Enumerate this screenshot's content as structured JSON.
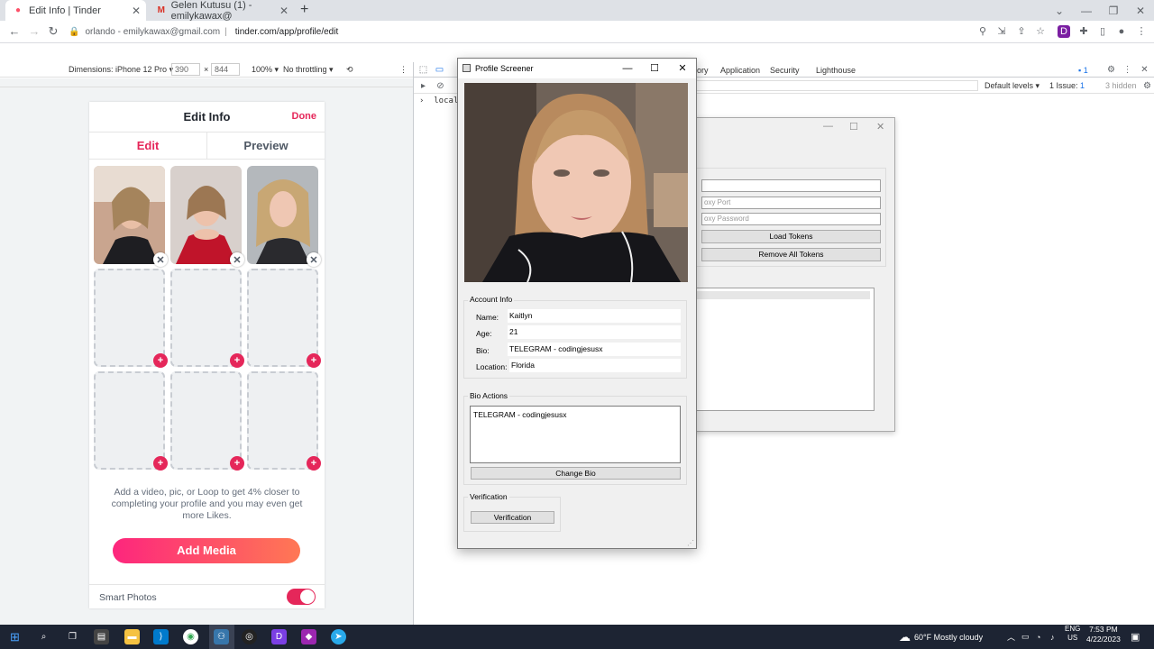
{
  "browser": {
    "tabs": [
      {
        "title": "Edit Info | Tinder",
        "active": true
      },
      {
        "title": "Gelen Kutusu (1) - emilykawax@",
        "active": false
      }
    ],
    "address": {
      "origin": "orlando - emilykawax@gmail.com",
      "separator": "|",
      "url": "tinder.com/app/profile/edit"
    }
  },
  "device_toolbar": {
    "dimensions_label": "Dimensions: iPhone 12 Pro",
    "width": "390",
    "times": "×",
    "height": "844",
    "zoom": "100%",
    "throttling": "No throttling"
  },
  "devtools": {
    "tabs": [
      "ory",
      "Application",
      "Security",
      "Lighthouse"
    ],
    "issues_badge": "1",
    "default_levels": "Default levels",
    "issue_count": "1 Issue:",
    "issue_num": "1",
    "hidden": "3 hidden",
    "console_line": "localSt"
  },
  "phone": {
    "title": "Edit Info",
    "done": "Done",
    "tab_edit": "Edit",
    "tab_preview": "Preview",
    "hint": "Add a video, pic, or Loop to get 4% closer to completing your profile and you may even get more Likes.",
    "add_media": "Add Media",
    "smart_photos": "Smart Photos",
    "smart_photos_on": true
  },
  "background_window": {
    "proxy_port_placeholder": "oxy Port",
    "proxy_password_placeholder": "oxy Password",
    "load_tokens": "Load Tokens",
    "remove_all_tokens": "Remove All Tokens"
  },
  "profile_screener": {
    "title": "Profile Screener",
    "account_info_label": "Account Info",
    "name_label": "Name:",
    "name_value": "Kaitlyn",
    "age_label": "Age:",
    "age_value": "21",
    "bio_label": "Bio:",
    "bio_value": "TELEGRAM - codingjesusx",
    "location_label": "Location:",
    "location_value": "Florida",
    "bio_actions_label": "Bio Actions",
    "bio_text": "TELEGRAM - codingjesusx",
    "change_bio": "Change Bio",
    "verification_label": "Verification",
    "verification_button": "Verification"
  },
  "taskbar": {
    "weather": "60°F  Mostly cloudy",
    "lang": "ENG",
    "region": "US",
    "time": "7:53 PM",
    "date": "4/22/2023"
  },
  "colors": {
    "tinder_pink": "#e5275a",
    "gradient_start": "#fd267d",
    "gradient_end": "#ff7854",
    "taskbar": "#1d2433"
  }
}
